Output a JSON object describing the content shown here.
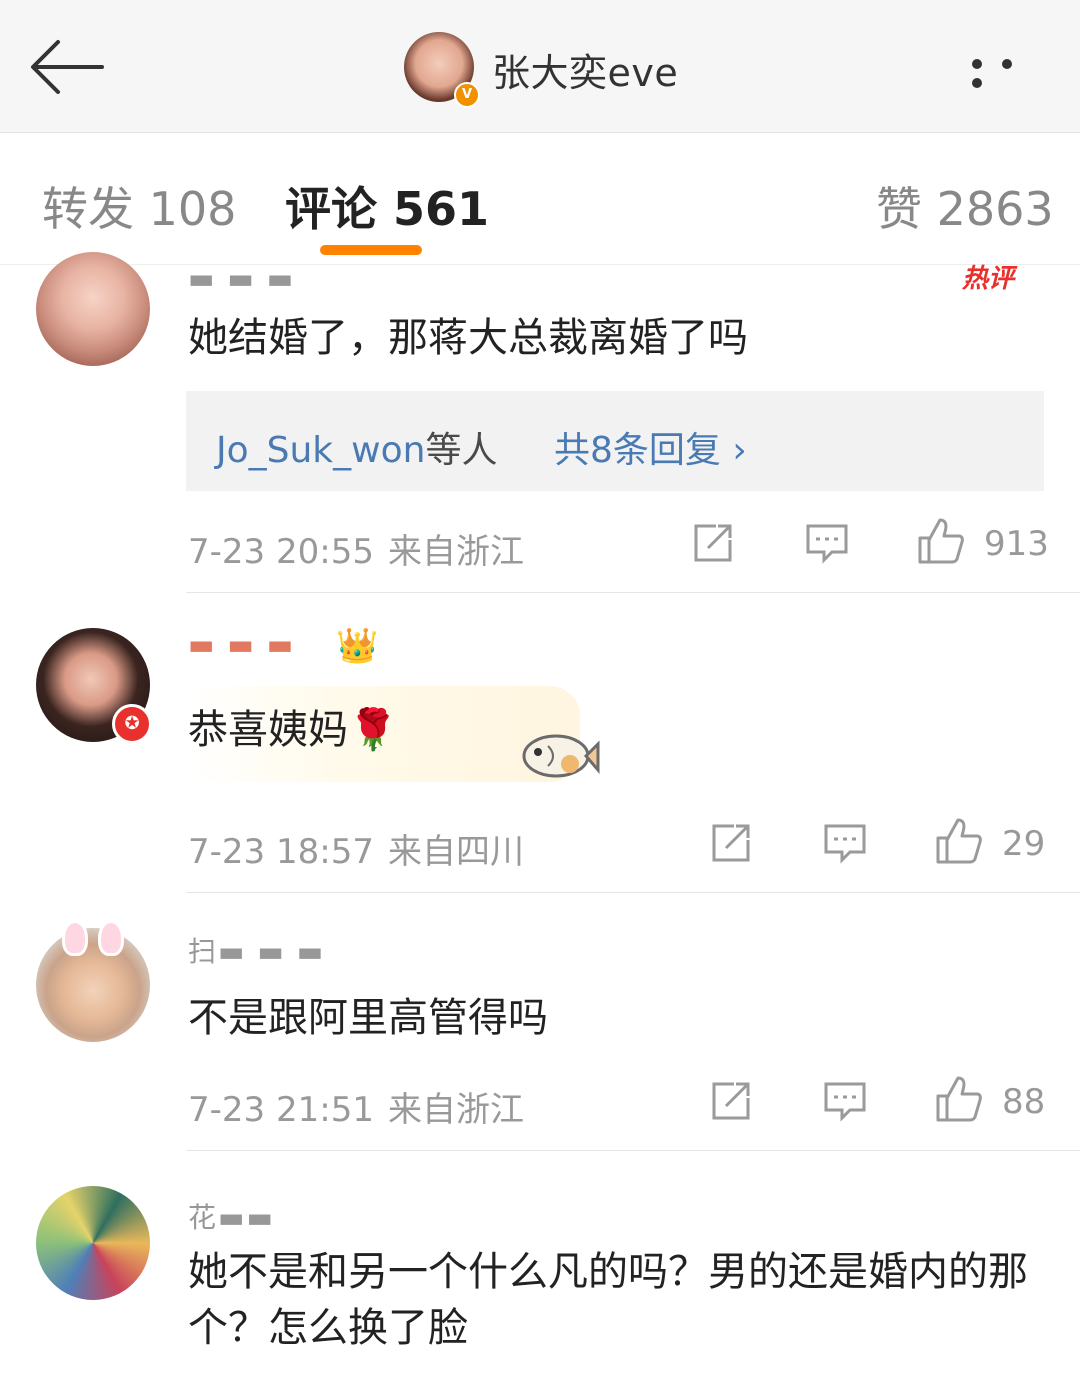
{
  "header": {
    "title": "张大奕eve",
    "verified": "V"
  },
  "tabs": [
    {
      "label": "转发 108"
    },
    {
      "label": "评论 561"
    },
    {
      "label": "赞 2863"
    }
  ],
  "comments": [
    {
      "username": "▬ ▬ ▬",
      "badge": "热评",
      "text": "她结婚了，那蒋大总裁离婚了吗",
      "replies": {
        "users": "Jo_Suk_won",
        "suffix": "等人",
        "count": "共8条回复 ›"
      },
      "time": "7-23 20:55",
      "location": "来自浙江",
      "likes": "913"
    },
    {
      "username": "▬ ▬ ▬",
      "text": "恭喜姨妈🌹",
      "time": "7-23 18:57",
      "location": "来自四川",
      "likes": "29"
    },
    {
      "username": "扫▬ ▬ ▬",
      "text": "不是跟阿里高管得吗",
      "time": "7-23 21:51",
      "location": "来自浙江",
      "likes": "88"
    },
    {
      "username": "花▬▬",
      "text": "她不是和另一个什么凡的吗？男的还是婚内的那个？怎么换了脸"
    }
  ]
}
